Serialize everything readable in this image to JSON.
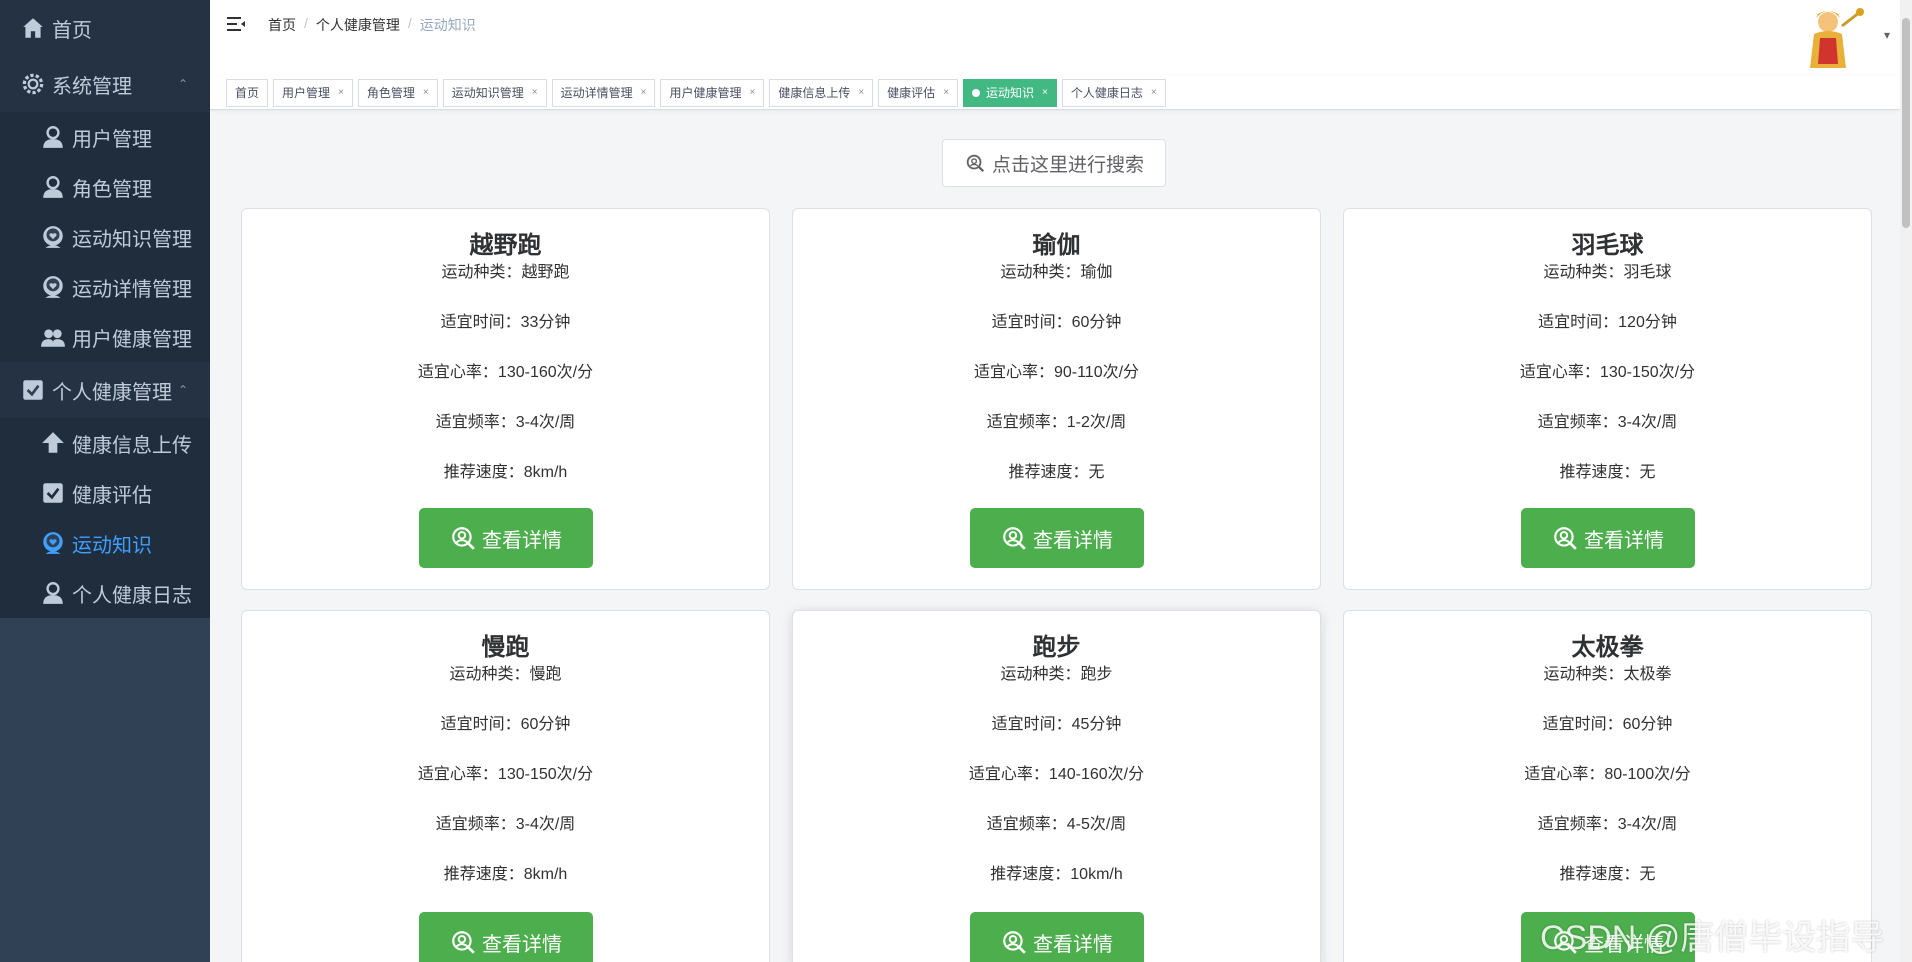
{
  "sidebar": {
    "home": "首页",
    "group_system": "系统管理",
    "system_items": [
      {
        "label": "用户管理",
        "icon": "user-icon"
      },
      {
        "label": "角色管理",
        "icon": "user-icon"
      },
      {
        "label": "运动知识管理",
        "icon": "heart-user-icon"
      },
      {
        "label": "运动详情管理",
        "icon": "heart-user-icon"
      },
      {
        "label": "用户健康管理",
        "icon": "group-icon"
      }
    ],
    "group_personal": "个人健康管理",
    "personal_items": [
      {
        "label": "健康信息上传",
        "icon": "upload-icon"
      },
      {
        "label": "健康评估",
        "icon": "checkbox-icon"
      },
      {
        "label": "运动知识",
        "icon": "heart-user-icon",
        "active": true
      },
      {
        "label": "个人健康日志",
        "icon": "user-icon"
      }
    ]
  },
  "breadcrumb": [
    "首页",
    "个人健康管理",
    "运动知识"
  ],
  "tags": [
    {
      "label": "首页",
      "closable": false
    },
    {
      "label": "用户管理",
      "closable": true
    },
    {
      "label": "角色管理",
      "closable": true
    },
    {
      "label": "运动知识管理",
      "closable": true
    },
    {
      "label": "运动详情管理",
      "closable": true
    },
    {
      "label": "用户健康管理",
      "closable": true
    },
    {
      "label": "健康信息上传",
      "closable": true
    },
    {
      "label": "健康评估",
      "closable": true
    },
    {
      "label": "运动知识",
      "closable": true,
      "active": true
    },
    {
      "label": "个人健康日志",
      "closable": true
    }
  ],
  "search_button": "点击这里进行搜索",
  "labels": {
    "type": "运动种类：",
    "time": "适宜时间：",
    "heart": "适宜心率：",
    "freq": "适宜频率：",
    "speed": "推荐速度："
  },
  "detail_button": "查看详情",
  "cards": [
    {
      "title": "越野跑",
      "type": "越野跑",
      "time": "33分钟",
      "heart": "130-160次/分",
      "freq": "3-4次/周",
      "speed": "8km/h"
    },
    {
      "title": "瑜伽",
      "type": "瑜伽",
      "time": "60分钟",
      "heart": "90-110次/分",
      "freq": "1-2次/周",
      "speed": "无"
    },
    {
      "title": "羽毛球",
      "type": "羽毛球",
      "time": "120分钟",
      "heart": "130-150次/分",
      "freq": "3-4次/周",
      "speed": "无"
    },
    {
      "title": "慢跑",
      "type": "慢跑",
      "time": "60分钟",
      "heart": "130-150次/分",
      "freq": "3-4次/周",
      "speed": "8km/h"
    },
    {
      "title": "跑步",
      "type": "跑步",
      "time": "45分钟",
      "heart": "140-160次/分",
      "freq": "4-5次/周",
      "speed": "10km/h"
    },
    {
      "title": "太极拳",
      "type": "太极拳",
      "time": "60分钟",
      "heart": "80-100次/分",
      "freq": "3-4次/周",
      "speed": "无"
    }
  ],
  "watermark": "CSDN @唐僧毕设指导",
  "colors": {
    "sidebar_bg": "#304156",
    "active_menu": "#409eff",
    "active_tag": "#42b983",
    "detail_button": "#4cae4c"
  }
}
